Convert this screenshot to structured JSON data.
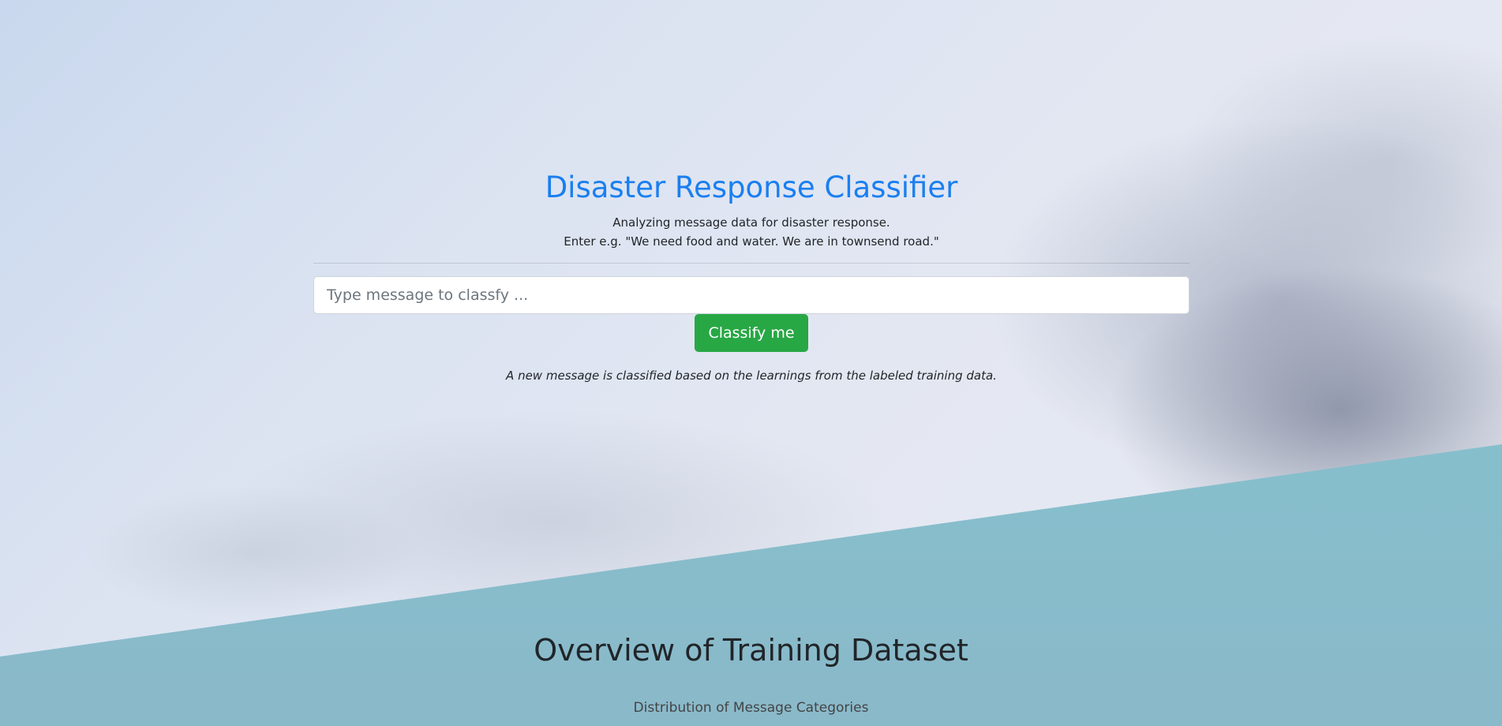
{
  "header": {
    "title": "Disaster Response Classifier",
    "subtitle_line1": "Analyzing message data for disaster response.",
    "subtitle_line2": "Enter e.g. \"We need food and water. We are in townsend road.\""
  },
  "classifier": {
    "input_placeholder": "Type message to classfy ...",
    "input_value": "",
    "button_label": "Classify me",
    "note": "A new message is classified based on the learnings from the labeled training data."
  },
  "overview": {
    "title": "Overview of Training Dataset",
    "chart_title": "Distribution of Message Categories"
  },
  "colors": {
    "title_blue": "#1a7ff0",
    "button_green": "#28a745",
    "teal_band": "#7cc4cc"
  }
}
